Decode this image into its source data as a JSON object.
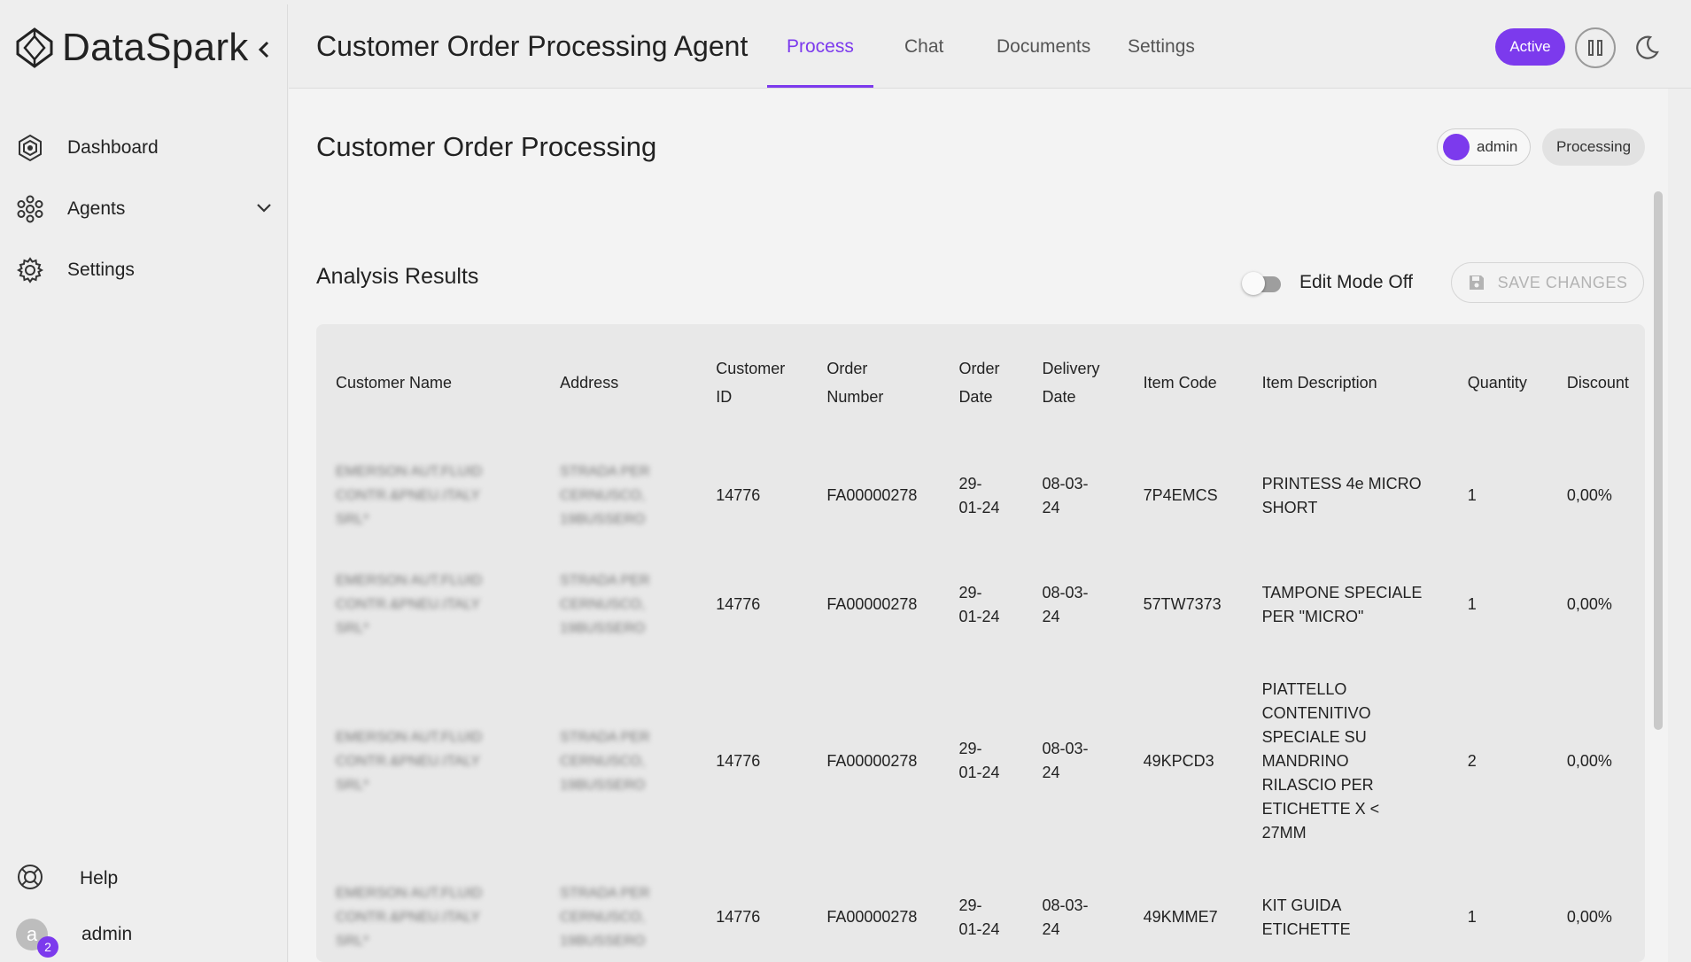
{
  "sidebar": {
    "brand": "DataSpark",
    "nav": [
      {
        "label": "Dashboard",
        "icon": "dashboard-icon"
      },
      {
        "label": "Agents",
        "icon": "agents-icon"
      },
      {
        "label": "Settings",
        "icon": "gear-icon"
      }
    ],
    "help_label": "Help",
    "user": {
      "initial": "a",
      "name": "admin",
      "badge_count": "2"
    }
  },
  "header": {
    "title": "Customer Order Processing Agent",
    "tabs": [
      {
        "label": "Process",
        "active": true
      },
      {
        "label": "Chat",
        "active": false
      },
      {
        "label": "Documents",
        "active": false
      },
      {
        "label": "Settings",
        "active": false
      }
    ],
    "status_pill": "Active"
  },
  "main": {
    "title": "Customer Order Processing",
    "user_chip": "admin",
    "status_chip": "Processing",
    "analysis_title": "Analysis Results",
    "edit_mode_label": "Edit Mode Off",
    "save_label": "SAVE CHANGES"
  },
  "table": {
    "columns": [
      "Customer Name",
      "Address",
      "Customer ID",
      "Order Number",
      "Order Date",
      "Delivery Date",
      "Item Code",
      "Item Description",
      "Quantity",
      "Discount"
    ],
    "column_lines": [
      [
        "Customer Name"
      ],
      [
        "Address"
      ],
      [
        "Customer",
        "ID"
      ],
      [
        "Order",
        "Number"
      ],
      [
        "Order",
        "Date"
      ],
      [
        "Delivery",
        "Date"
      ],
      [
        "Item Code"
      ],
      [
        "Item Description"
      ],
      [
        "Quantity"
      ],
      [
        "Discount"
      ]
    ],
    "rows": [
      {
        "customer_name": [
          "EMERSON AUT.FLUID",
          "CONTR.&PNEU.ITALY",
          "SRL*"
        ],
        "address": [
          "STRADA PER",
          "CERNUSCO,",
          "19BUSSERO"
        ],
        "customer_id": "14776",
        "order_number": "FA00000278",
        "order_date": [
          "29-",
          "01-24"
        ],
        "delivery_date": [
          "08-03-",
          "24"
        ],
        "item_code": "7P4EMCS",
        "item_description": [
          "PRINTESS 4e MICRO",
          "SHORT"
        ],
        "quantity": "1",
        "discount": "0,00%"
      },
      {
        "customer_name": [
          "EMERSON AUT.FLUID",
          "CONTR.&PNEU.ITALY",
          "SRL*"
        ],
        "address": [
          "STRADA PER",
          "CERNUSCO,",
          "19BUSSERO"
        ],
        "customer_id": "14776",
        "order_number": "FA00000278",
        "order_date": [
          "29-",
          "01-24"
        ],
        "delivery_date": [
          "08-03-",
          "24"
        ],
        "item_code": "57TW7373",
        "item_description": [
          "TAMPONE SPECIALE",
          "PER \"MICRO\""
        ],
        "quantity": "1",
        "discount": "0,00%"
      },
      {
        "customer_name": [
          "EMERSON AUT.FLUID",
          "CONTR.&PNEU.ITALY",
          "SRL*"
        ],
        "address": [
          "STRADA PER",
          "CERNUSCO,",
          "19BUSSERO"
        ],
        "customer_id": "14776",
        "order_number": "FA00000278",
        "order_date": [
          "29-",
          "01-24"
        ],
        "delivery_date": [
          "08-03-",
          "24"
        ],
        "item_code": "49KPCD3",
        "item_description": [
          "PIATTELLO",
          "CONTENITIVO",
          "SPECIALE SU",
          "MANDRINO",
          "RILASCIO PER",
          "ETICHETTE X <",
          "27MM"
        ],
        "quantity": "2",
        "discount": "0,00%"
      },
      {
        "customer_name": [
          "EMERSON AUT.FLUID",
          "CONTR.&PNEU.ITALY",
          "SRL*"
        ],
        "address": [
          "STRADA PER",
          "CERNUSCO,",
          "19BUSSERO"
        ],
        "customer_id": "14776",
        "order_number": "FA00000278",
        "order_date": [
          "29-",
          "01-24"
        ],
        "delivery_date": [
          "08-03-",
          "24"
        ],
        "item_code": "49KMME7",
        "item_description": [
          "KIT GUIDA",
          "ETICHETTE"
        ],
        "quantity": "1",
        "discount": "0,00%"
      }
    ]
  },
  "colors": {
    "accent": "#7c3aed",
    "background": "#eeeeee",
    "panel": "#f3f3f3",
    "table_bg": "#e8e8e8"
  }
}
